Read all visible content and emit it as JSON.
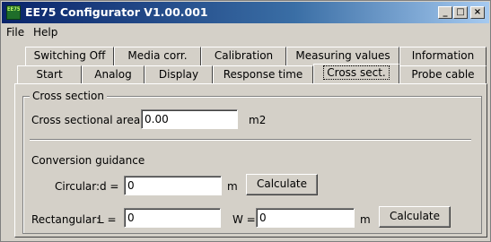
{
  "window": {
    "title": "EE75 Configurator V1.00.001",
    "icon_text": "EE75",
    "controls": [
      "_",
      "□",
      "×"
    ]
  },
  "menu": {
    "file": "File",
    "help": "Help"
  },
  "tabs_row1": [
    "Switching Off",
    "Media corr.",
    "Calibration",
    "Measuring values",
    "Information"
  ],
  "tabs_row2": [
    "Start",
    "Analog",
    "Display",
    "Response time",
    "Cross sect.",
    "Probe cable"
  ],
  "active_tab": "Cross sect.",
  "cross_section": {
    "group_title": "Cross section",
    "area_label": "Cross sectional area:",
    "area_value": "0.00",
    "area_unit": "m2"
  },
  "conversion": {
    "heading": "Conversion guidance",
    "circular_label": "Circular:",
    "d_label": "d =",
    "d_value": "0",
    "d_unit": "m",
    "circular_button": "Calculate",
    "rect_label": "Rectangular:",
    "l_label": "L =",
    "l_value": "0",
    "w_label": "W =",
    "w_value": "0",
    "w_unit": "m",
    "rect_button": "Calculate"
  }
}
